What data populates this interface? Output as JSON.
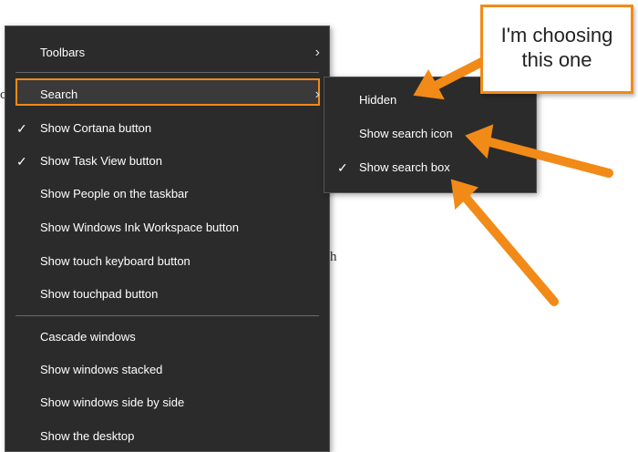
{
  "background": {
    "fragment_1": "c",
    "fragment_2": "h"
  },
  "menu": {
    "items": [
      {
        "label": "Toolbars",
        "checked": false,
        "submenu": true
      },
      {
        "label": "Search",
        "checked": false,
        "submenu": true
      },
      {
        "label": "Show Cortana button",
        "checked": true
      },
      {
        "label": "Show Task View button",
        "checked": true
      },
      {
        "label": "Show People on the taskbar",
        "checked": false
      },
      {
        "label": "Show Windows Ink Workspace button",
        "checked": false
      },
      {
        "label": "Show touch keyboard button",
        "checked": false
      },
      {
        "label": "Show touchpad button",
        "checked": false
      },
      {
        "label": "Cascade windows",
        "checked": false
      },
      {
        "label": "Show windows stacked",
        "checked": false
      },
      {
        "label": "Show windows side by side",
        "checked": false
      },
      {
        "label": "Show the desktop",
        "checked": false
      }
    ],
    "check_glyph": "✓",
    "chevron_glyph": "›"
  },
  "submenu": {
    "items": [
      {
        "label": "Hidden",
        "checked": false
      },
      {
        "label": "Show search icon",
        "checked": false
      },
      {
        "label": "Show search box",
        "checked": true
      }
    ]
  },
  "callout": {
    "line1": "I'm choosing",
    "line2": "this one"
  },
  "colors": {
    "menu_bg": "#2b2b2b",
    "accent_orange": "#f28a17",
    "menu_text": "#ffffff"
  }
}
